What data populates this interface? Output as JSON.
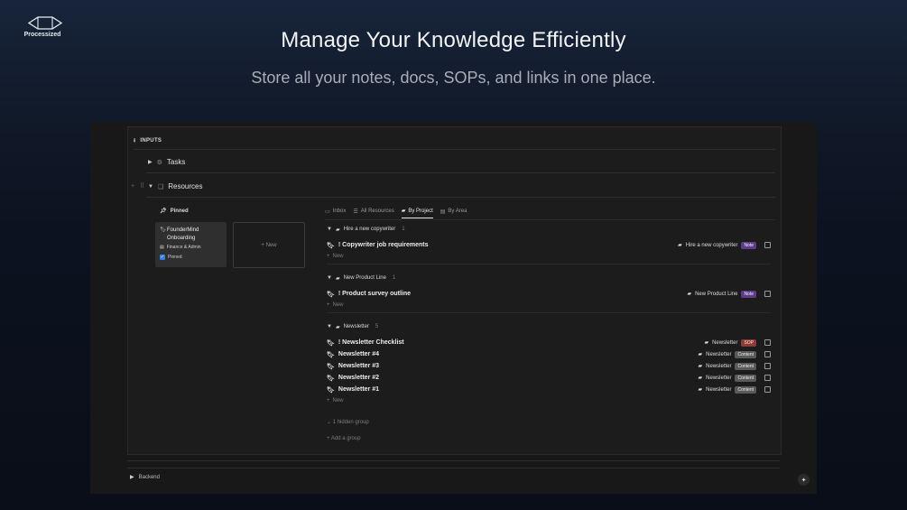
{
  "brand": {
    "name": "Processized"
  },
  "hero": {
    "title": "Manage Your Knowledge Efficiently",
    "subtitle": "Store all your notes, docs, SOPs, and links in one place."
  },
  "app": {
    "inputs_label": "INPUTS",
    "tasks_label": "Tasks",
    "resources_label": "Resources",
    "pinned": {
      "title": "Pinned",
      "card": {
        "title": "FounderMind Onboarding",
        "area": "Finance & Admin",
        "pinned_label": "Pinned",
        "pinned_checked": true
      },
      "new_label": "+ New"
    },
    "tabs": [
      {
        "label": "Inbox",
        "icon": "inbox-icon",
        "active": false
      },
      {
        "label": "All Resources",
        "icon": "list-icon",
        "active": false
      },
      {
        "label": "By Project",
        "icon": "folder-icon",
        "active": true
      },
      {
        "label": "By Area",
        "icon": "area-icon",
        "active": false
      }
    ],
    "groups": [
      {
        "name": "Hire a new copywriter",
        "count": "1",
        "items": [
          {
            "title": "! Copywriter job requirements",
            "project": "Hire a new copywriter",
            "tag": "Note",
            "tag_color": "#5b3e8a"
          }
        ]
      },
      {
        "name": "New Product Line",
        "count": "1",
        "items": [
          {
            "title": "! Product survey outline",
            "project": "New Product Line",
            "tag": "Note",
            "tag_color": "#5b3e8a"
          }
        ]
      },
      {
        "name": "Newsletter",
        "count": "5",
        "items": [
          {
            "title": "! Newsletter Checklist",
            "project": "Newsletter",
            "tag": "SOP",
            "tag_color": "#8e3a32"
          },
          {
            "title": "Newsletter #4",
            "project": "Newsletter",
            "tag": "Content",
            "tag_color": "#5a5a5a"
          },
          {
            "title": "Newsletter #3",
            "project": "Newsletter",
            "tag": "Content",
            "tag_color": "#5a5a5a"
          },
          {
            "title": "Newsletter #2",
            "project": "Newsletter",
            "tag": "Content",
            "tag_color": "#5a5a5a"
          },
          {
            "title": "Newsletter #1",
            "project": "Newsletter",
            "tag": "Content",
            "tag_color": "#5a5a5a"
          }
        ]
      }
    ],
    "new_row_label": "New",
    "hidden_group": "1 hidden group",
    "add_group": "Add a group",
    "backend_label": "Backend"
  }
}
